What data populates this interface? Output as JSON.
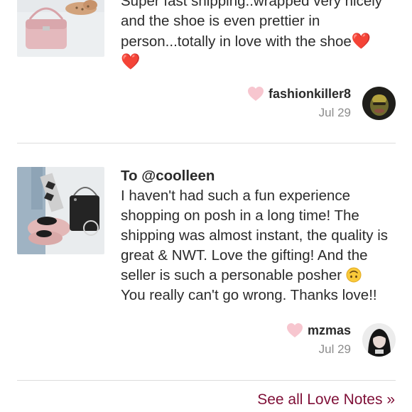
{
  "notes": [
    {
      "title": "",
      "text": "Super fast shipping..wrapped very nicely and the shoe is even prettier in person...totally in love with the shoe",
      "emoji": "❤️",
      "author": "fashionkiller8",
      "date": "Jul 29",
      "thumbnail_icon": "product-photo-pink-bag-and-shoes",
      "avatar_icon": "user-avatar-fashionkiller8"
    },
    {
      "title": "To @coolleen",
      "text": "I haven't had such a fun experience shopping on posh in a long time! The shipping was almost instant, the quality is great & NWT. Love the gifting! And the seller is such a personable posher",
      "emoji_icon": "upside-down-face-emoji",
      "text_after": "You really can't go wrong. Thanks love!!",
      "author": "mzmas",
      "date": "Jul 29",
      "thumbnail_icon": "product-photo-shoes",
      "avatar_icon": "user-avatar-mzmas"
    }
  ],
  "see_all_label": "See all Love Notes »",
  "colors": {
    "link": "#7f0f37",
    "like_heart": "#f7c6cf",
    "date_text": "#8c8c8c",
    "divider": "#dcdcdc"
  }
}
